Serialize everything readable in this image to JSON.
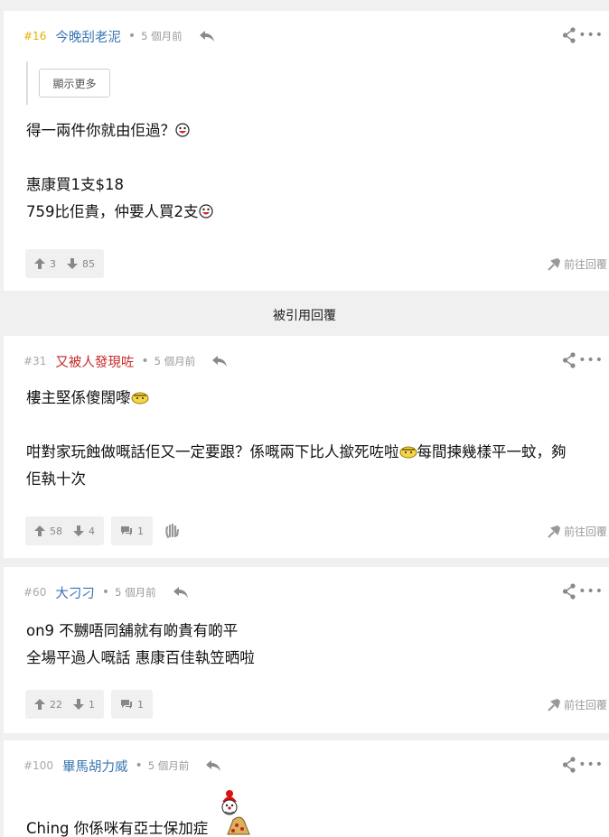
{
  "posts": [
    {
      "number": "#16",
      "username": "今晚刮老泥",
      "time": "5 個月前",
      "show_more": "顯示更多",
      "lines": [
        "得一兩件你就由佢過？",
        "",
        "惠康買1支$18",
        "759比佢貴，仲要人買2支"
      ],
      "up": "3",
      "down": "85",
      "reply_link": "前往回覆"
    },
    {
      "number": "#31",
      "username": "又被人發現咗",
      "time": "5 個月前",
      "lines": [
        "樓主堅係傻闊嚟",
        "",
        "咁對家玩蝕做嘅話佢又一定要跟？係嘅兩下比人撳死咗啦",
        "每間揀幾樣平一蚊，夠",
        "佢執十次"
      ],
      "up": "58",
      "down": "4",
      "quote_count": "1",
      "reply_link": "前往回覆"
    },
    {
      "number": "#60",
      "username": "大刁刁",
      "time": "5 個月前",
      "lines": [
        "on9 不嬲唔同舖就有啲貴有啲平",
        "全場平過人嘅話 惠康百佳執笠晒啦"
      ],
      "up": "22",
      "down": "1",
      "quote_count": "1",
      "reply_link": "前往回覆"
    },
    {
      "number": "#100",
      "username": "畢馬胡力威",
      "time": "5 個月前",
      "lines": [
        "Ching 你係咪有亞士保加症"
      ]
    }
  ],
  "quoted_section": "被引用回覆",
  "colors": {
    "gold_number": "#e4b100",
    "username_blue": "#3a75b0",
    "username_red": "#c62828"
  },
  "icons": [
    "reply-icon",
    "share-icon",
    "more-icon",
    "thumb-up-icon",
    "thumb-down-icon",
    "comment-icon",
    "wave-icon",
    "goto-reply-icon",
    "laugh-emoji",
    "shy-emoji",
    "clown-emoji"
  ]
}
